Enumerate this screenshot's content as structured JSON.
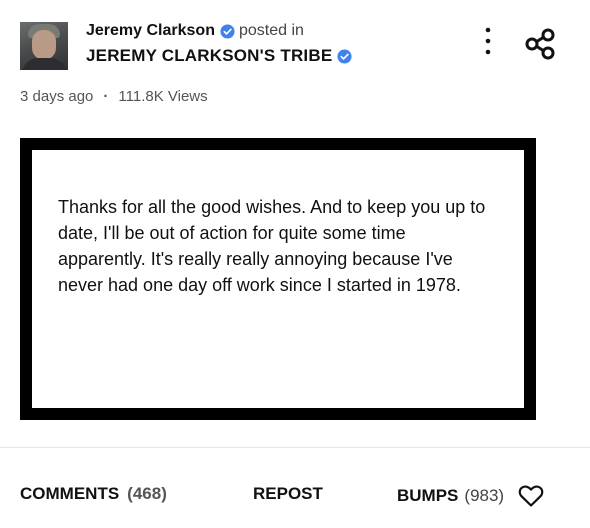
{
  "post": {
    "author": "Jeremy Clarkson",
    "posted_in": "posted in",
    "tribe": "JEREMY CLARKSON'S TRIBE",
    "time_ago": "3 days ago",
    "separator": "·",
    "views": "111.8K Views"
  },
  "card": {
    "text": "Thanks for all the good wishes. And to keep you up to date, I'll be out of action for quite some time apparently. It's really really annoying because I've never had one day off work since I started in 1978."
  },
  "actions": {
    "comments_label": "COMMENTS",
    "comments_count": "(468)",
    "repost_label": "REPOST",
    "bumps_label": "BUMPS",
    "bumps_count": "(983)"
  },
  "icons": {
    "verified": "verified-badge-icon",
    "more": "kebab-menu-icon",
    "share": "share-icon",
    "like": "heart-icon"
  },
  "colors": {
    "verified_blue": "#3f82ee",
    "text": "#111111",
    "muted": "#555555"
  }
}
